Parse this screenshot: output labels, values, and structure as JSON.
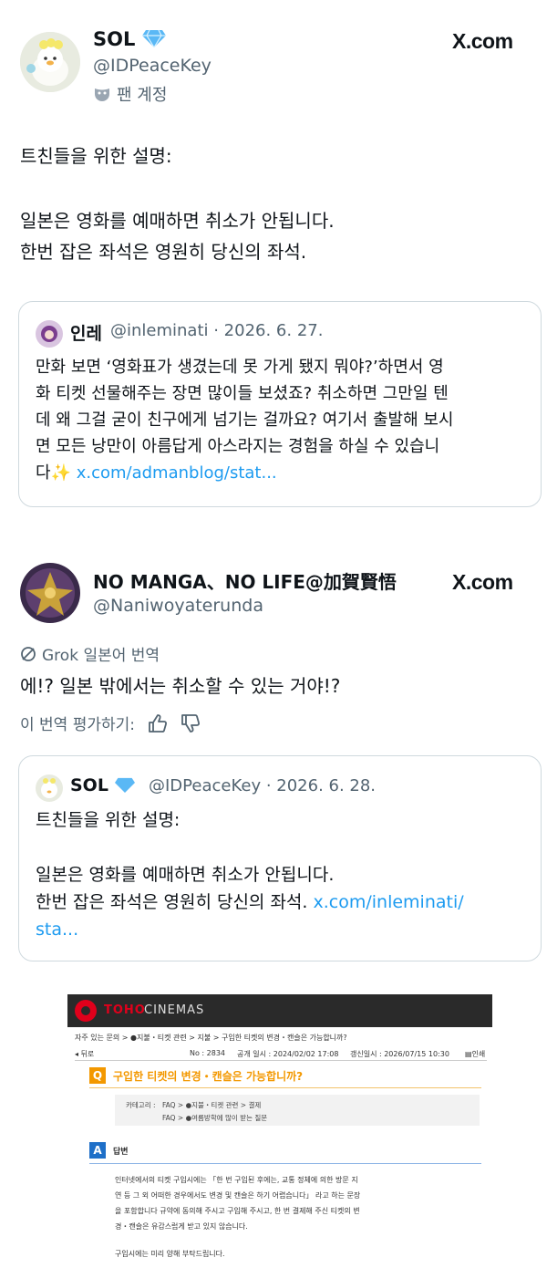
{
  "post1": {
    "name": "SOL",
    "handle": "@IDPeaceKey",
    "badge": "팬 계정",
    "source": "X.com",
    "line1": "트친들을 위한 설명:",
    "line2": "일본은 영화를 예매하면 취소가 안됩니다.",
    "line3": "한번 잡은 좌석은 영원히 당신의 좌석.",
    "quote": {
      "name": "인레",
      "meta": "@inleminati · 2026. 6. 27.",
      "lines": [
        "만화 보면 ‘영화표가 생겼는데 못 가게 됐지 뭐야?’하면서 영",
        "화 티켓 선물해주는 장면 많이들 보셨죠? 취소하면 그만일 텐",
        "데 왜 그걸 굳이 친구에게 넘기는 걸까요? 여기서 출발해 보시",
        "면 모든 낭만이 아름답게 아스라지는 경험을 하실 수 있습니"
      ],
      "last_prefix": "다✨",
      "link": "x.com/admanblog/stat..."
    }
  },
  "post2": {
    "name": "NO MANGA、NO LIFE@加賀賢悟",
    "handle": "@Naniwoyaterunda",
    "source": "X.com",
    "translate_label": "Grok 일본어 번역",
    "text": "에!? 일본 밖에서는 취소할 수 있는 거야!?",
    "rate_label": "이 번역 평가하기:",
    "quote": {
      "name": "SOL",
      "meta": "@IDPeaceKey · 2026. 6. 28.",
      "line1": "트친들을 위한 설명:",
      "line2": "일본은 영화를 예매하면 취소가 안됩니다.",
      "line3_prefix": "한번 잡은 좌석은 영원히 당신의 좌석. ",
      "line3_link": "x.com/inleminati/",
      "line4_link": "sta..."
    }
  },
  "toho": {
    "brand1": "TOHO",
    "brand2": "CINEMAS",
    "breadcrumb": "자주 있는 문의   >   ●지불・티켓 관련   >   지불   >   구입한 티켓의 변경・캔슬은 가능합니까?",
    "back": "뒤로",
    "no": "No : 2834",
    "published": "공개 일시 : 2024/02/02 17:08",
    "updated": "갱신일시 : 2026/07/15 10:30",
    "print": "인쇄",
    "q_badge": "Q",
    "question": "구입한 티켓의 변경・캔슬은 가능합니까?",
    "cat_label": "카테고리 :",
    "cat1": "FAQ > ●지불・티켓 관련 > 결제",
    "cat2": "FAQ > ●여름방학에 많이 받는 질문",
    "a_badge": "A",
    "answer_label": "답변",
    "answer_lines": [
      "인터넷에서의 티켓 구입시에는 「한 번 구입된 후에는, 교통 정체에 의한 방문 지",
      "연 등 그 외 어떠한 경우에서도 변경 및 캔슬은 하기 어렵습니다」 라고 하는 문장",
      "을 포함합니다 규약에 동의해 주시고 구입해 주시고, 한 번 결제해 주신 티켓의 변",
      "경・캔슬은 유감스럽게 받고 있지 않습니다."
    ],
    "answer_end": "구입시에는 미리 양해 부탁드립니다."
  },
  "colors": {
    "link": "#1d9bf0",
    "gray": "#536471",
    "toho_red": "#e0001b",
    "q_orange": "#f39800",
    "a_blue": "#1e6fc8"
  }
}
